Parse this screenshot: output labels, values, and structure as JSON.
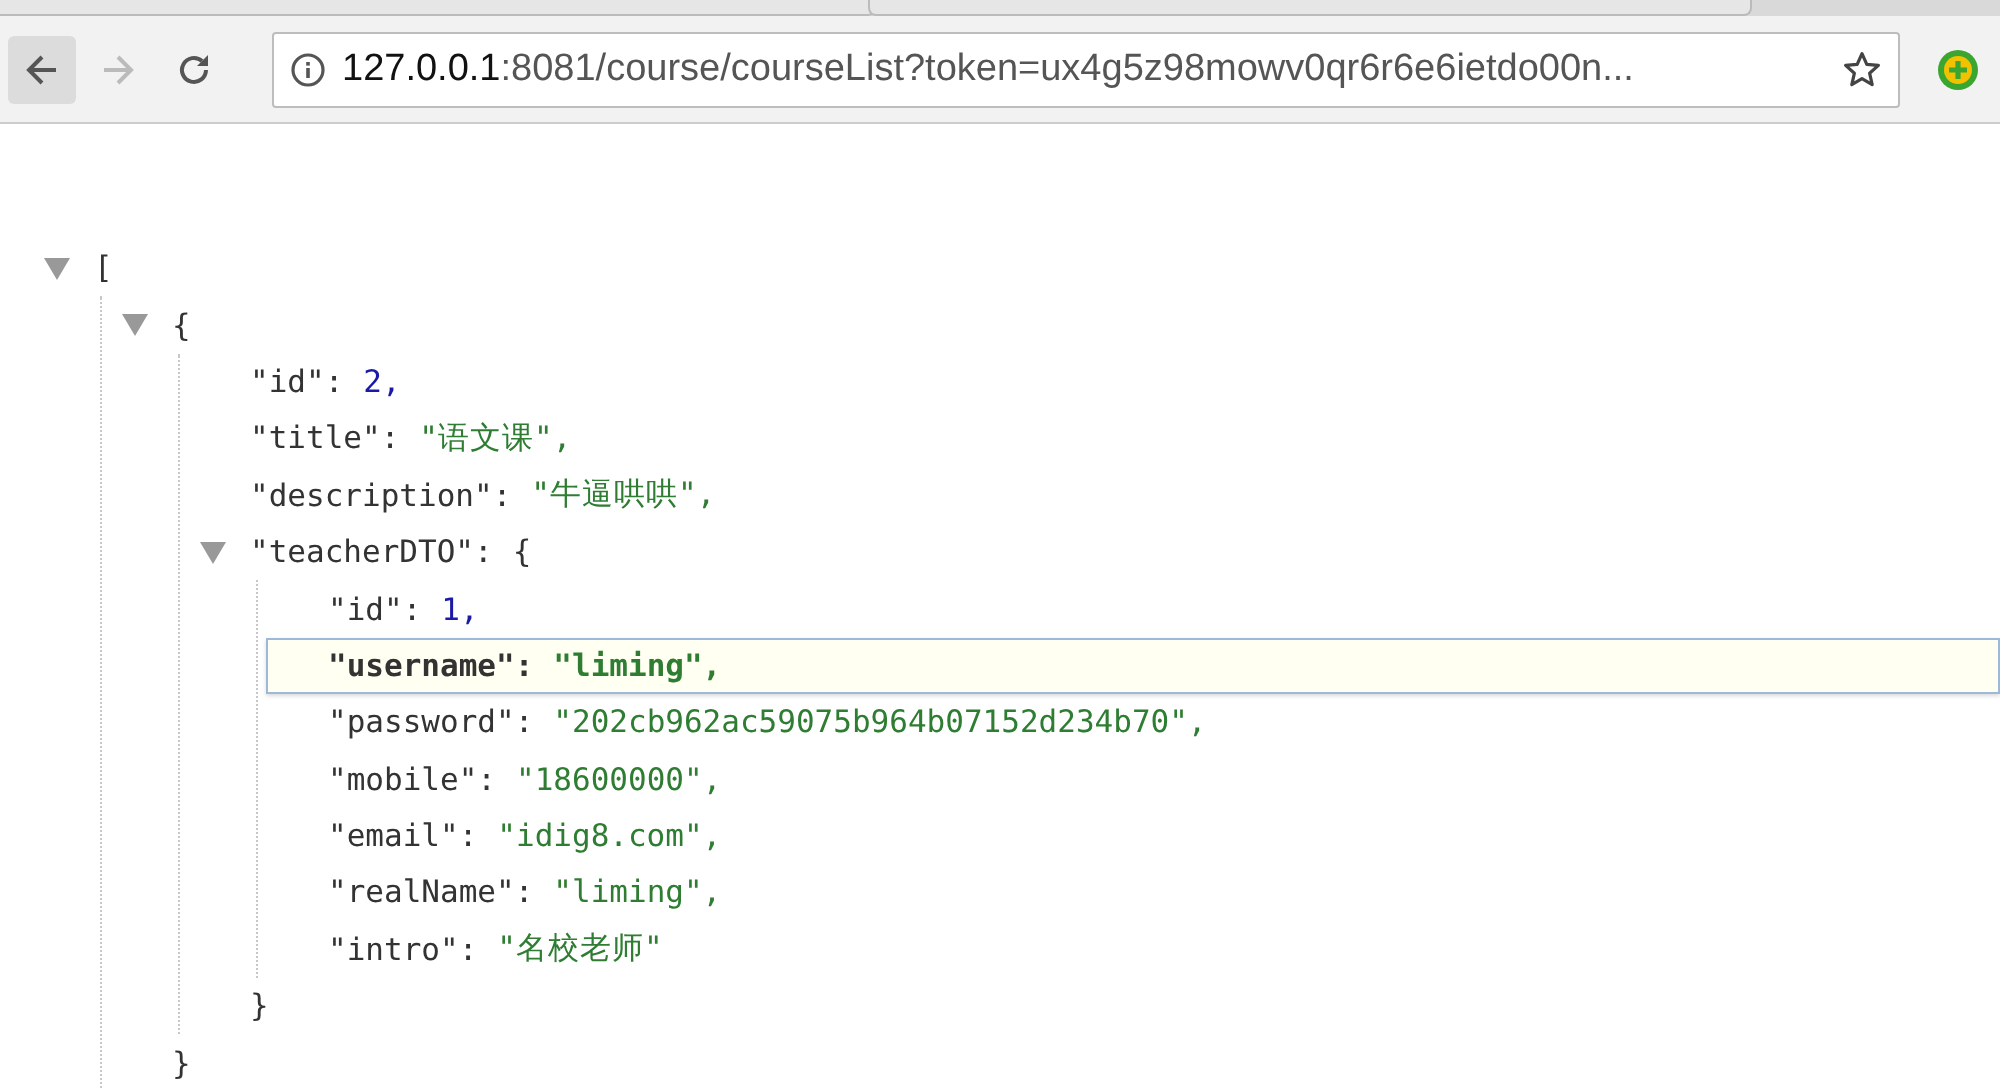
{
  "toolbar": {
    "url_host": "127.0.0.1",
    "url_rest": ":8081/course/courseList?token=ux4g5z98mowv0qr6r6e6ietdo00n..."
  },
  "tree": {
    "open": "[",
    "expanded": true,
    "children": [
      {
        "open": "{",
        "expanded": true,
        "close": "}",
        "children": [
          {
            "key": "\"id\":",
            "value": "2,",
            "kind": "number",
            "selected": false
          },
          {
            "key": "\"title\":",
            "value": "\"语文课\",",
            "kind": "string",
            "selected": false
          },
          {
            "key": "\"description\":",
            "value": "\"牛逼哄哄\",",
            "kind": "string",
            "selected": false
          },
          {
            "key": "\"teacherDTO\":",
            "open": "{",
            "expanded": true,
            "close": "}",
            "children": [
              {
                "key": "\"id\":",
                "value": "1,",
                "kind": "number",
                "selected": false
              },
              {
                "key": "\"username\":",
                "value": "\"liming\",",
                "kind": "string",
                "selected": true
              },
              {
                "key": "\"password\":",
                "value": "\"202cb962ac59075b964b07152d234b70\",",
                "kind": "string",
                "selected": false
              },
              {
                "key": "\"mobile\":",
                "value": "\"18600000\",",
                "kind": "string",
                "selected": false
              },
              {
                "key": "\"email\":",
                "value": "\"idig8.com\",",
                "kind": "string",
                "selected": false
              },
              {
                "key": "\"realName\":",
                "value": "\"liming\",",
                "kind": "string",
                "selected": false
              },
              {
                "key": "\"intro\":",
                "value": "\"名校老师\"",
                "kind": "string",
                "selected": false
              }
            ]
          }
        ]
      }
    ]
  }
}
